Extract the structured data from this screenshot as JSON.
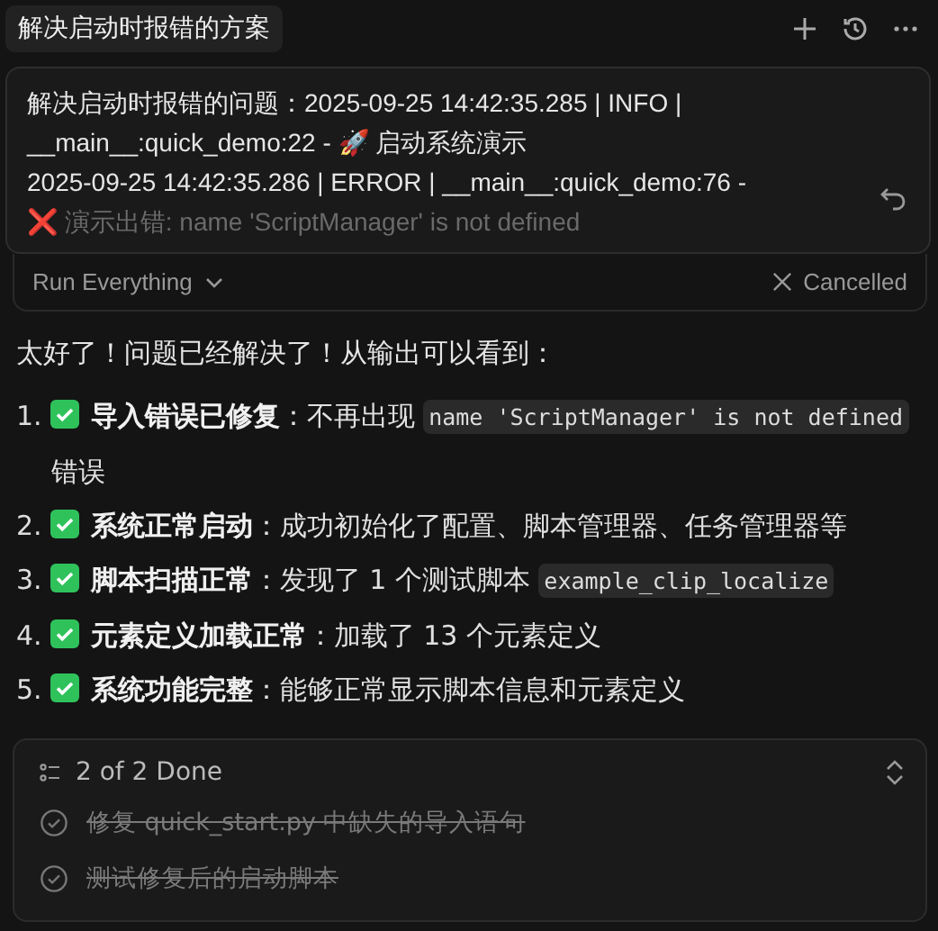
{
  "tab": {
    "title": "解决启动时报错的方案"
  },
  "message": {
    "lines": [
      "解决启动时报错的问题：2025-09-25 14:42:35.285 | INFO     |",
      "__main__:quick_demo:22 - 🚀 启动系统演示",
      "2025-09-25 14:42:35.286 | ERROR    | __main__:quick_demo:76 -",
      "❌ 演示出错: name 'ScriptManager' is not defined"
    ]
  },
  "run": {
    "label": "Run Everything",
    "status": "Cancelled"
  },
  "intro": "太好了！问题已经解决了！从输出可以看到：",
  "items": [
    {
      "number": "1.",
      "title": "导入错误已修复",
      "parts": [
        {
          "kind": "text",
          "text": "：不再出现 "
        },
        {
          "kind": "code",
          "text": "name 'ScriptManager' is not defined"
        },
        {
          "kind": "text",
          "text": " 错误"
        }
      ]
    },
    {
      "number": "2.",
      "title": "系统正常启动",
      "parts": [
        {
          "kind": "text",
          "text": "：成功初始化了配置、脚本管理器、任务管理器等"
        }
      ]
    },
    {
      "number": "3.",
      "title": "脚本扫描正常",
      "parts": [
        {
          "kind": "text",
          "text": "：发现了 1 个测试脚本 "
        },
        {
          "kind": "code",
          "text": "example_clip_localize"
        }
      ]
    },
    {
      "number": "4.",
      "title": "元素定义加载正常",
      "parts": [
        {
          "kind": "text",
          "text": "：加载了 13 个元素定义"
        }
      ]
    },
    {
      "number": "5.",
      "title": "系统功能完整",
      "parts": [
        {
          "kind": "text",
          "text": "：能够正常显示脚本信息和元素定义"
        }
      ]
    }
  ],
  "todos": {
    "summary": "2 of 2 Done",
    "items": [
      {
        "text": "修复 quick_start.py 中缺失的导入语句",
        "checked": true
      },
      {
        "text": "测试修复后的启动脚本",
        "checked": true
      }
    ]
  }
}
